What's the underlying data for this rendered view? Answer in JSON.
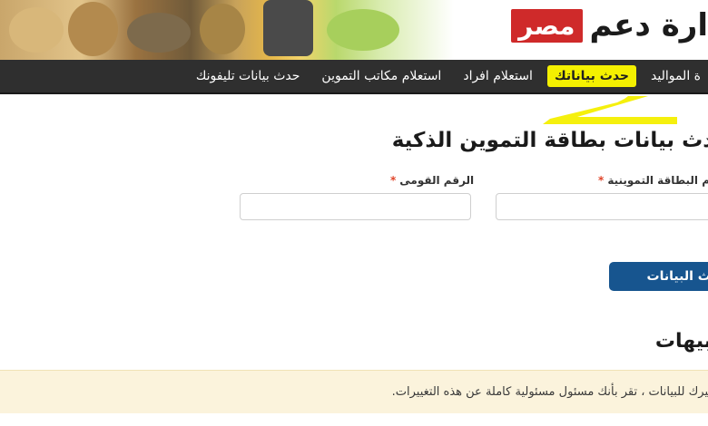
{
  "brand": {
    "text": "ارة دعم",
    "badge": "مصر"
  },
  "nav": {
    "items": [
      {
        "label": "ة المواليد"
      },
      {
        "label": "حدث بياناتك",
        "active": true
      },
      {
        "label": "استعلام افراد"
      },
      {
        "label": "استعلام مكاتب التموين"
      },
      {
        "label": "حدث بيانات تليفونك"
      }
    ]
  },
  "form": {
    "title": "دث بيانات بطاقة التموين الذكية",
    "card_label": "م البطاقة التموينية",
    "national_id_label": "الرقم القومى",
    "required_mark": "*",
    "submit_label": "حدث البيانات"
  },
  "notes": {
    "title": "بيهات",
    "text": "ييرك للبيانات ، تقر بأنك مسئول مسئولية كاملة عن هذه التغييرات."
  },
  "colors": {
    "navbar": "#2f2f2f",
    "active_tab": "#f4f000",
    "submit": "#17558f",
    "badge": "#cf2a2a",
    "notice_bg": "#fbf3dc",
    "required": "#e0452a",
    "highlighter": "#f4ef00"
  }
}
